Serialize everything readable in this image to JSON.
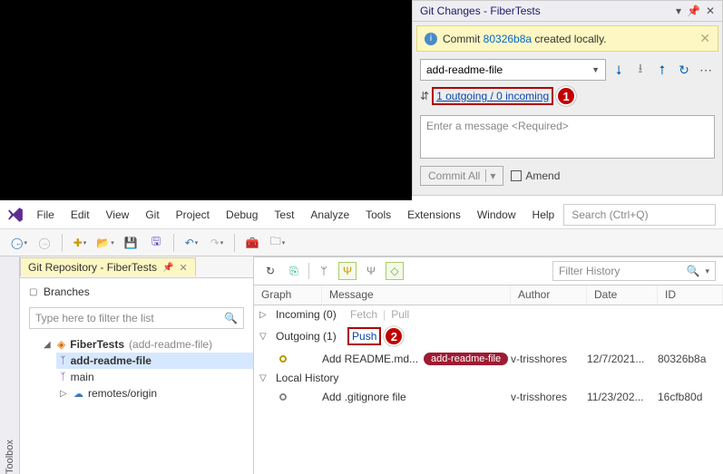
{
  "git_changes": {
    "title": "Git Changes - FiberTests",
    "info_prefix": "Commit ",
    "info_link": "80326b8a",
    "info_suffix": " created locally.",
    "branch": "add-readme-file",
    "sync_text": "1 outgoing / 0 incoming",
    "message_placeholder": "Enter a message <Required>",
    "commit_btn": "Commit All",
    "amend_label": "Amend",
    "callout": "1"
  },
  "menu": {
    "items": [
      "File",
      "Edit",
      "View",
      "Git",
      "Project",
      "Debug",
      "Test",
      "Analyze",
      "Tools",
      "Extensions",
      "Window",
      "Help"
    ],
    "search_placeholder": "Search (Ctrl+Q)"
  },
  "repo_tab": {
    "title": "Git Repository - FiberTests"
  },
  "branches_pane": {
    "header": "Branches",
    "filter_placeholder": "Type here to filter the list",
    "repo_name": "FiberTests",
    "repo_current": "(add-readme-file)",
    "items": {
      "current": "add-readme-file",
      "main": "main",
      "remotes": "remotes/origin"
    }
  },
  "history": {
    "filter_placeholder": "Filter History",
    "cols": {
      "graph": "Graph",
      "message": "Message",
      "author": "Author",
      "date": "Date",
      "id": "ID"
    },
    "incoming": {
      "label": "Incoming (0)",
      "fetch": "Fetch",
      "pull": "Pull"
    },
    "outgoing": {
      "label": "Outgoing (1)",
      "push": "Push",
      "callout": "2"
    },
    "local_label": "Local History",
    "commits": [
      {
        "msg": "Add README.md...",
        "branch": "add-readme-file",
        "author": "v-trisshores",
        "date": "12/7/2021...",
        "id": "80326b8a"
      },
      {
        "msg": "Add .gitignore file",
        "branch": "",
        "author": "v-trisshores",
        "date": "11/23/202...",
        "id": "16cfb80d"
      }
    ]
  }
}
